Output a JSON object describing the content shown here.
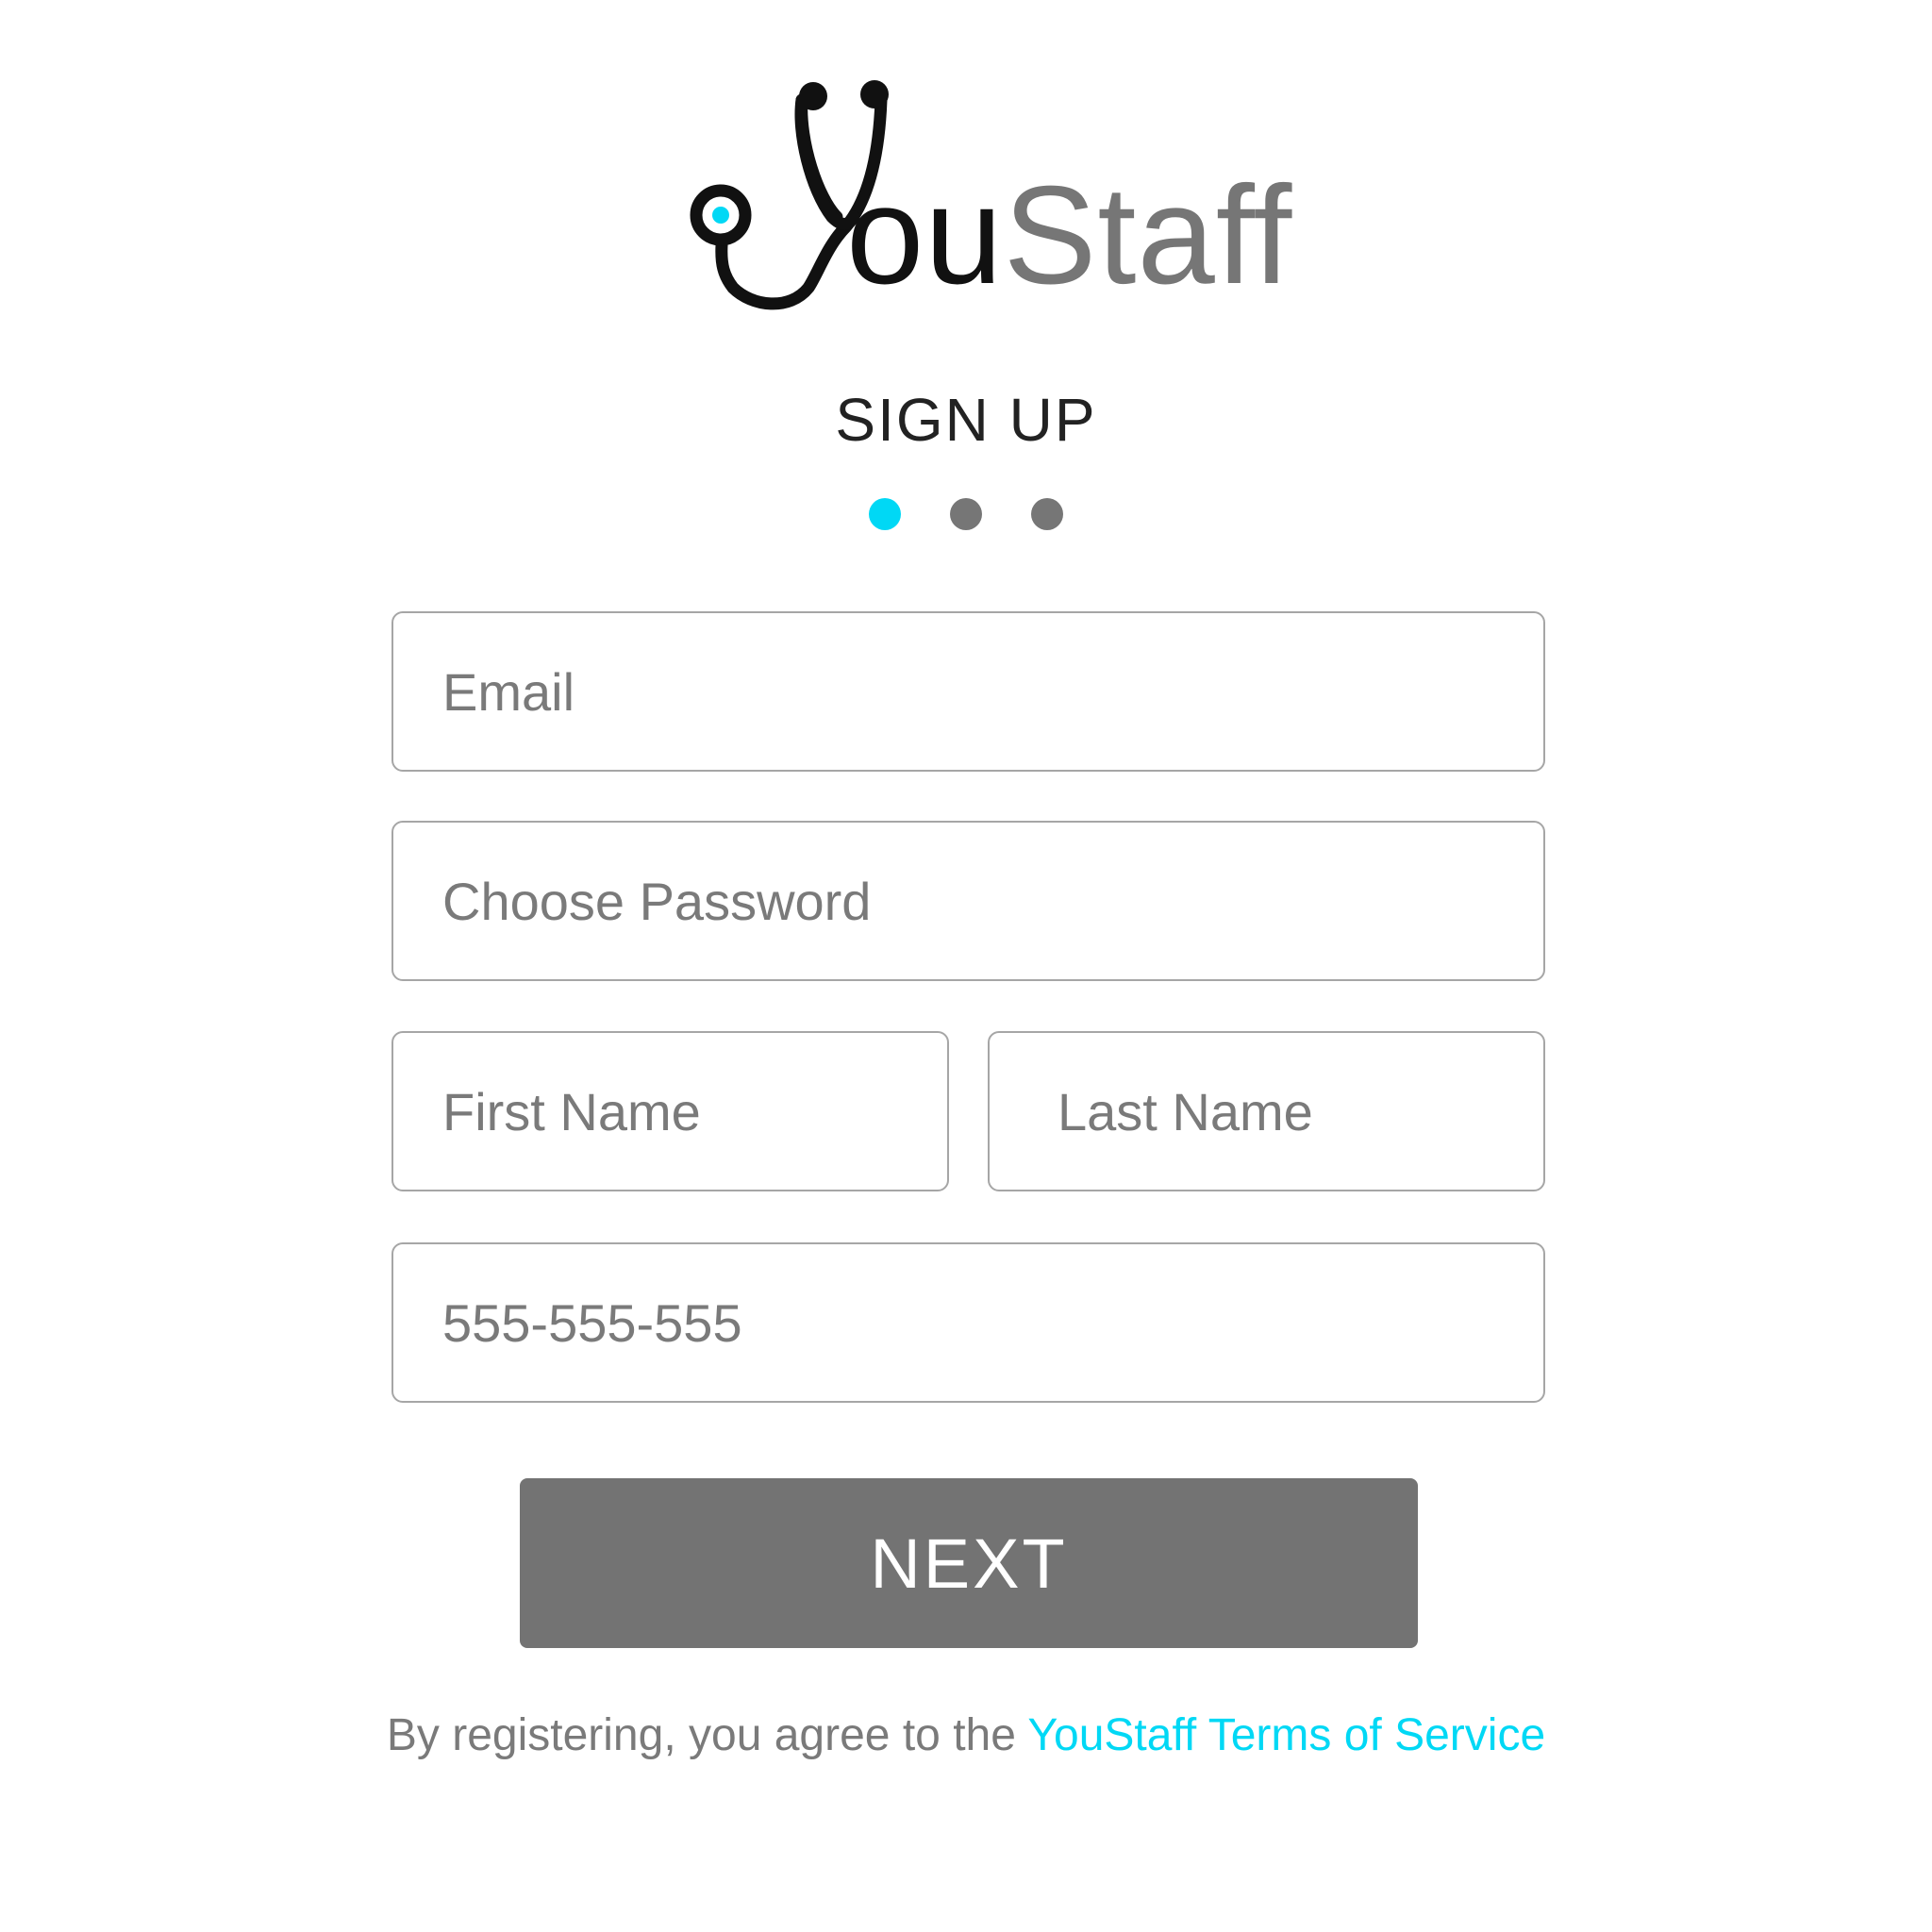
{
  "brand": {
    "logo_text_dark": "ou",
    "logo_text_light": "Staff",
    "accent_color": "#00d8f5",
    "logo_icon": "stethoscope-icon"
  },
  "header": {
    "title": "SIGN UP"
  },
  "steps": {
    "count": 3,
    "active_index": 0
  },
  "form": {
    "email_placeholder": "Email",
    "password_placeholder": "Choose Password",
    "first_name_placeholder": "First Name",
    "last_name_placeholder": "Last Name",
    "phone_placeholder": "555-555-555",
    "next_label": "NEXT"
  },
  "footer": {
    "terms_prefix": "By registering, you agree to the ",
    "terms_link": "YouStaff Terms of Service"
  },
  "colors": {
    "button": "#737373",
    "inactive_dot": "#767676",
    "border": "#a6a6a6"
  }
}
